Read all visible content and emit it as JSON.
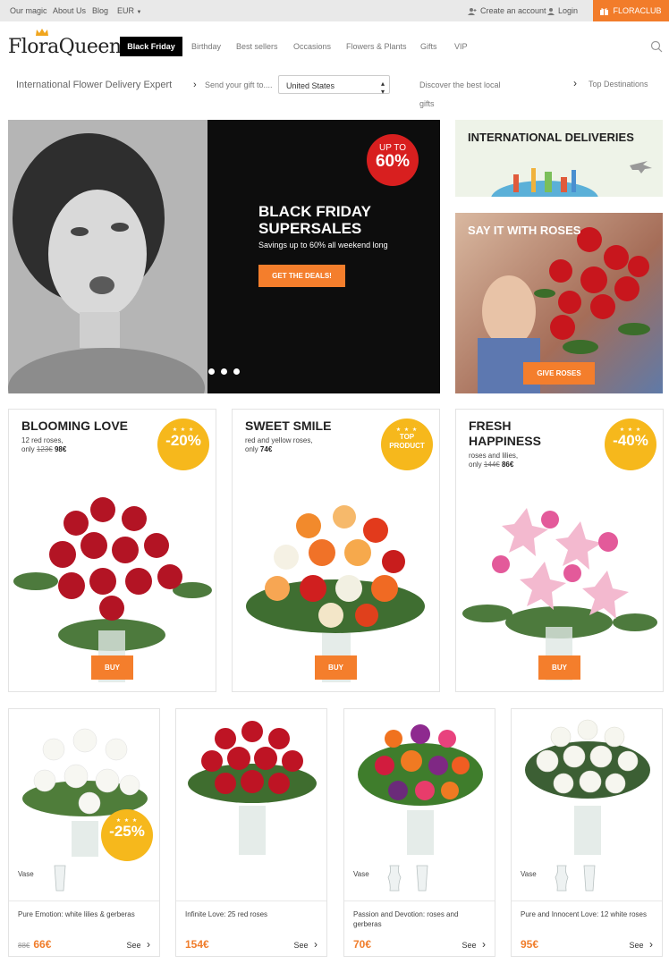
{
  "topbar": {
    "our_magic": "Our magic",
    "about_us": "About Us",
    "blog": "Blog",
    "currency": "EUR",
    "create_account": "Create an account",
    "login": "Login",
    "floraclub": "FLORACLUB"
  },
  "header": {
    "logo_text": "FloraQueen",
    "nav": {
      "black_friday": "Black Friday",
      "birthday": "Birthday",
      "best_sellers": "Best sellers",
      "occasions": "Occasions",
      "flowers_plants": "Flowers & Plants",
      "gifts": "Gifts",
      "vip": "VIP"
    }
  },
  "inforow": {
    "tagline": "International Flower Delivery Expert",
    "send_gift": "Send your gift to....",
    "country": "United States",
    "discover_line1": "Discover the best local",
    "discover_line2": "gifts",
    "top_destinations": "Top Destinations"
  },
  "hero": {
    "badge_top": "UP TO",
    "badge_value": "60%",
    "title_line1": "BLACK FRIDAY",
    "title_line2": "SUPERSALES",
    "subtitle": "Savings up to 60% all weekend long",
    "cta": "GET THE DEALS!"
  },
  "promos": {
    "international": "INTERNATIONAL DELIVERIES",
    "roses_title": "SAY IT WITH ROSES",
    "roses_cta": "GIVE ROSES"
  },
  "featured": [
    {
      "title_line1": "BLOOMING LOVE",
      "title_line2": "",
      "desc": "12 red roses,",
      "only": "only",
      "old_price": "123€",
      "price": "98€",
      "badge_stars": "★ ★ ★",
      "badge": "-20%",
      "buy": "BUY"
    },
    {
      "title_line1": "SWEET SMILE",
      "title_line2": "",
      "desc": "red and yellow roses,",
      "only": "only",
      "old_price": "",
      "price": "74€",
      "badge_stars": "★ ★ ★",
      "badge_line1": "TOP",
      "badge_line2": "PRODUCT",
      "buy": "BUY"
    },
    {
      "title_line1": "FRESH",
      "title_line2": "HAPPINESS",
      "desc": "roses and lilies,",
      "only": "only",
      "old_price": "144€",
      "price": "86€",
      "badge_stars": "★ ★ ★",
      "badge": "-40%",
      "buy": "BUY"
    }
  ],
  "products": [
    {
      "vase_label": "Vase",
      "name": "Pure Emotion: white lilies & gerberas",
      "old_price": "88€",
      "price": "66€",
      "see": "See",
      "badge_stars": "★ ★ ★",
      "badge": "-25%"
    },
    {
      "vase_label": "",
      "name": "Infinite Love: 25 red roses",
      "old_price": "",
      "price": "154€",
      "see": "See"
    },
    {
      "vase_label": "Vase",
      "name": "Passion and Devotion: roses and gerberas",
      "old_price": "",
      "price": "70€",
      "see": "See"
    },
    {
      "vase_label": "Vase",
      "name": "Pure and Innocent Love: 12 white roses",
      "old_price": "",
      "price": "95€",
      "see": "See"
    }
  ],
  "colors": {
    "accent_orange": "#f47e2c",
    "badge_yellow": "#f6b81c",
    "badge_red": "#d81f1f",
    "black": "#0d0d0d"
  }
}
